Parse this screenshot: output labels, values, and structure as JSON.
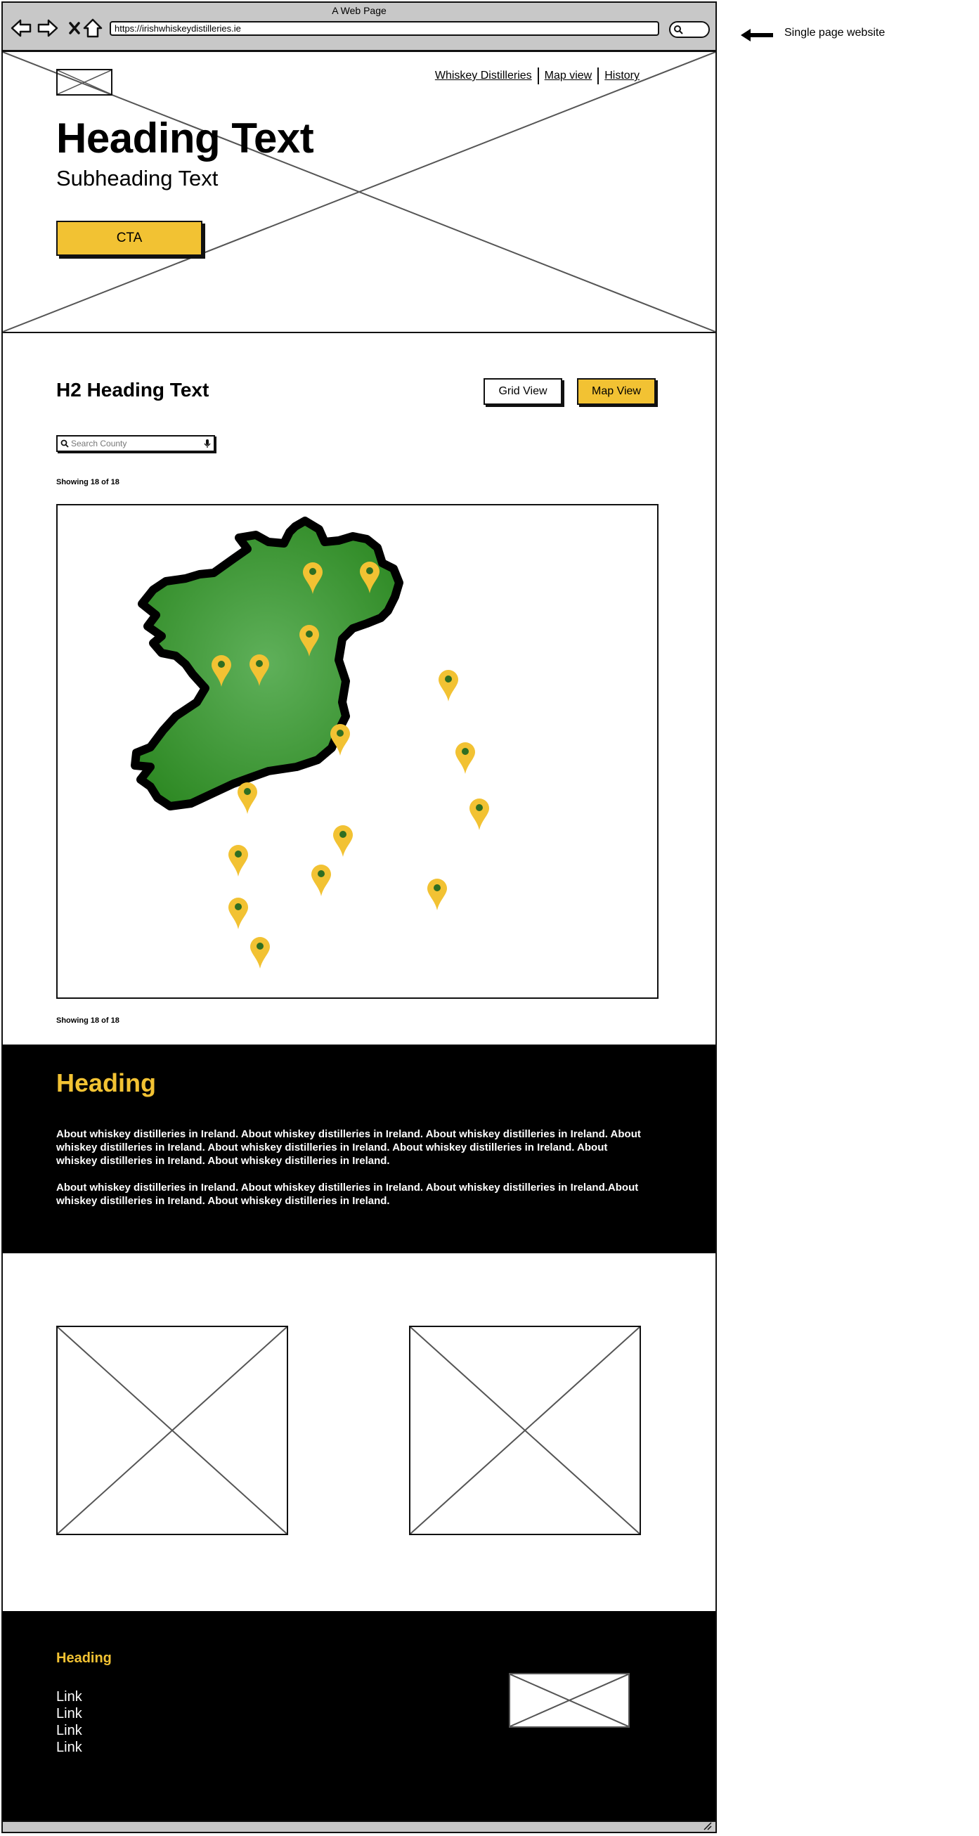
{
  "browser": {
    "window_title": "A Web Page",
    "url": "https://irishwhiskeydistilleries.ie"
  },
  "annotation": {
    "label": "Single page website"
  },
  "hero": {
    "nav_links": [
      "Whiskey Distilleries",
      "Map view",
      "History"
    ],
    "heading": "Heading Text",
    "subheading": "Subheading Text",
    "cta_label": "CTA"
  },
  "listing": {
    "heading": "H2 Heading Text",
    "grid_view_label": "Grid View",
    "map_view_label": "Map View",
    "active_view": "Map View",
    "search_placeholder": "Search County",
    "showing_top": "Showing 18 of 18",
    "showing_bottom": "Showing 18 of 18",
    "map_pin_count": 16
  },
  "about": {
    "heading": "Heading",
    "paragraph_1": "About whiskey distilleries in Ireland. About whiskey distilleries in Ireland. About whiskey distilleries in Ireland. About whiskey distilleries in Ireland. About whiskey distilleries in Ireland. About whiskey distilleries in Ireland. About whiskey distilleries in Ireland. About whiskey distilleries in Ireland.",
    "paragraph_2": "About whiskey distilleries in Ireland. About whiskey distilleries in Ireland. About whiskey distilleries in Ireland.About whiskey distilleries in Ireland. About whiskey distilleries in Ireland."
  },
  "footer": {
    "heading": "Heading",
    "links": [
      "Link",
      "Link",
      "Link",
      "Link"
    ]
  },
  "colors": {
    "accent": "#f2c233",
    "dark": "#000000",
    "map_green": "#3a8f2e",
    "chrome_gray": "#c8c8c8"
  }
}
